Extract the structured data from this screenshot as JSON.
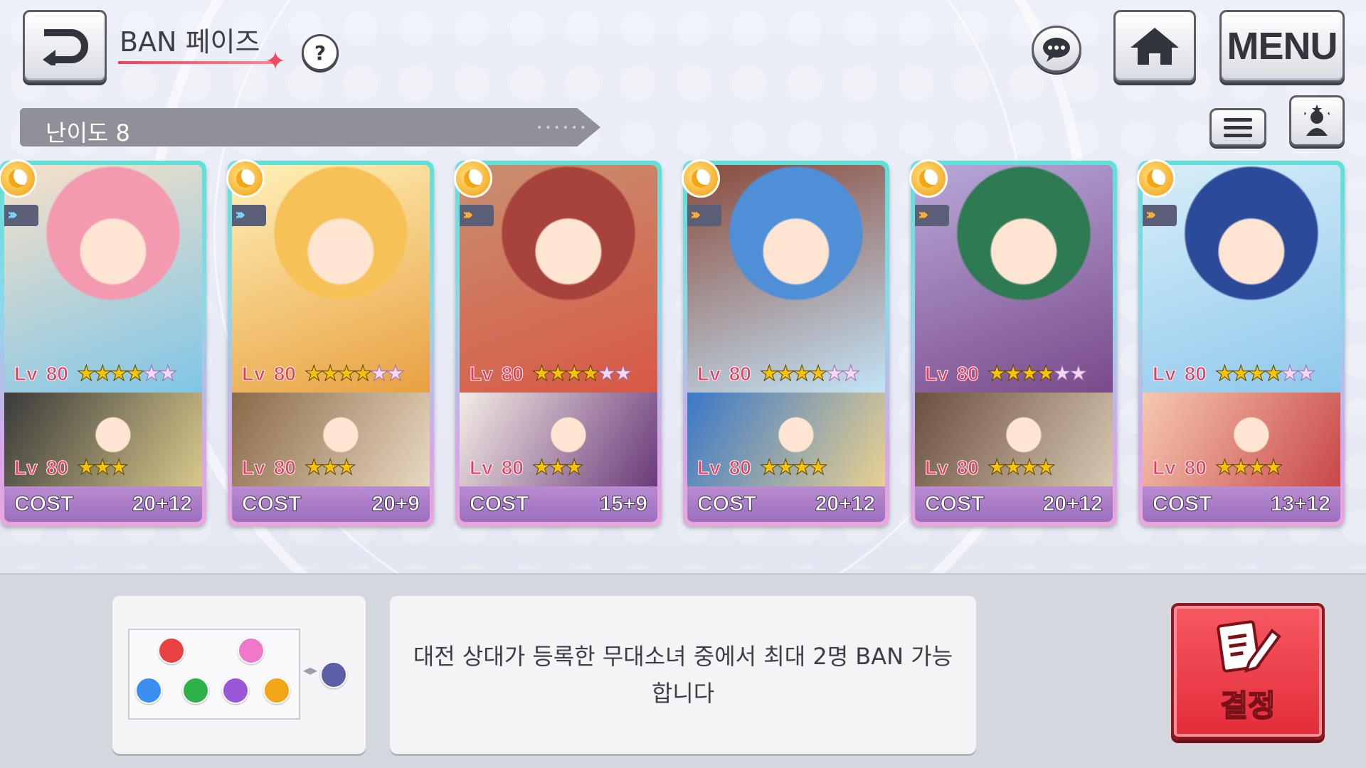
{
  "header": {
    "title": "BAN 페이즈",
    "help_label": "?",
    "menu_label": "MENU"
  },
  "difficulty": {
    "label": "난이도 8"
  },
  "cards": [
    {
      "main_level": "80",
      "main_stars_filled": 4,
      "sub_level": "80",
      "sub_stars": 3,
      "cost_label": "COST",
      "cost_value": "20+12",
      "rank": "blue"
    },
    {
      "main_level": "80",
      "main_stars_filled": 4,
      "sub_level": "80",
      "sub_stars": 3,
      "cost_label": "COST",
      "cost_value": "20+9",
      "rank": "blue"
    },
    {
      "main_level": "80",
      "main_stars_filled": 4,
      "sub_level": "80",
      "sub_stars": 3,
      "cost_label": "COST",
      "cost_value": "15+9",
      "rank": "gold"
    },
    {
      "main_level": "80",
      "main_stars_filled": 4,
      "sub_level": "80",
      "sub_stars": 4,
      "cost_label": "COST",
      "cost_value": "20+12",
      "rank": "gold"
    },
    {
      "main_level": "80",
      "main_stars_filled": 4,
      "sub_level": "80",
      "sub_stars": 4,
      "cost_label": "COST",
      "cost_value": "20+12",
      "rank": "gold"
    },
    {
      "main_level": "80",
      "main_stars_filled": 4,
      "sub_level": "80",
      "sub_stars": 4,
      "cost_label": "COST",
      "cost_value": "13+12",
      "rank": "gold"
    }
  ],
  "lv_label": "Lv",
  "message": {
    "text": "대전 상대가 등록한 무대소녀 중에서 최대 2명 BAN 가능합니다"
  },
  "decide_button": {
    "label": "결정"
  },
  "colors": {
    "accent_red": "#e32d3a",
    "card_frame": "#5ee0d8",
    "cost_bar": "#9c6fbf",
    "level_text": "#e9395a"
  },
  "icons": [
    "back-icon",
    "chat-icon",
    "home-icon",
    "list-icon",
    "character-icon",
    "moon-attribute-icon",
    "decide-pen-icon"
  ]
}
